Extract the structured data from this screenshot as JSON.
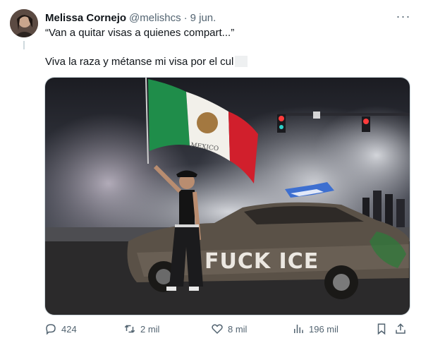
{
  "user": {
    "name": "Melissa Cornejo",
    "handle": "@melishcs",
    "separator": "·",
    "date": "9 jun."
  },
  "quote": "“Van a quitar visas a quienes compart...”",
  "text": "Viva la raza y métanse mi visa por el cul",
  "media": {
    "car_graffiti": "FUCK ICE",
    "flag_text": "MEXICO"
  },
  "actions": {
    "replies": "424",
    "reposts": "2 mil",
    "likes": "8 mil",
    "views": "196 mil"
  },
  "colors": {
    "text": "#0f1419",
    "secondary": "#536471",
    "border": "#cfd9de"
  }
}
